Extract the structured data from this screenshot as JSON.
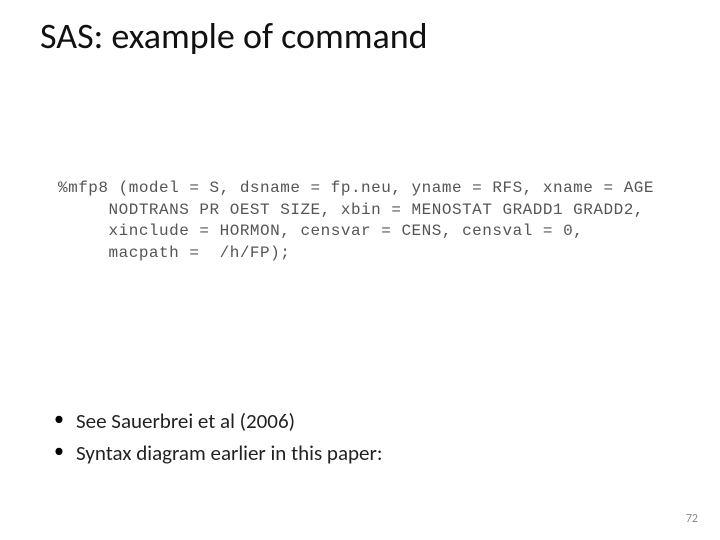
{
  "title": "SAS: example of command",
  "code": {
    "line1": "%mfp8 (model = S, dsname = fp.neu, yname = RFS, xname = AGE",
    "line2": "     NODTRANS PR OEST SIZE, xbin = MENOSTAT GRADD1 GRADD2,",
    "line3": "     xinclude = HORMON, censvar = CENS, censval = 0,",
    "line4": "     macpath =  /h/FP);"
  },
  "bullets": [
    "See Sauerbrei et al (2006)",
    "Syntax diagram earlier in this paper:"
  ],
  "page_number": "72"
}
